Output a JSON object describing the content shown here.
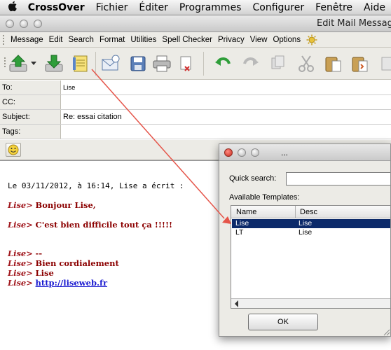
{
  "menubar": {
    "app": "CrossOver",
    "items": [
      "Fichier",
      "Éditer",
      "Programmes",
      "Configurer",
      "Fenêtre",
      "Aide"
    ]
  },
  "window": {
    "title": "Edit Mail Message"
  },
  "appmenu": {
    "items": [
      "Message",
      "Edit",
      "Search",
      "Format",
      "Utilities",
      "Spell Checker",
      "Privacy",
      "View",
      "Options"
    ]
  },
  "fields": {
    "to": {
      "label": "To:",
      "value": "Lise"
    },
    "cc": {
      "label": "CC:",
      "value": ""
    },
    "subject": {
      "label": "Subject:",
      "value": "Re: essai citation"
    },
    "tags": {
      "label": "Tags:",
      "value": ""
    }
  },
  "message": {
    "intro": "Le 03/11/2012, à 16:14, Lise a écrit :",
    "quote_prefix": "Lise>",
    "q1": "Bonjour Lise,",
    "q2": "C'est bien difficile tout ça !!!!!",
    "sig_dash": "--",
    "sig1": "Bien cordialement",
    "sig2": "Lise",
    "sig_link": "http://liseweb.fr"
  },
  "dialog": {
    "title": "...",
    "search_label": "Quick search:",
    "search_value": "",
    "templates_label": "Available Templates:",
    "col_name": "Name",
    "col_desc": "Desc",
    "rows": [
      {
        "name": "Lise",
        "desc": "Lise"
      },
      {
        "name": "LT",
        "desc": "Lise"
      }
    ],
    "ok_label": "OK"
  },
  "colors": {
    "quote": "#a0161c",
    "link": "#1a1ad0",
    "selection": "#0c2a6a",
    "arrow": "#e5554a"
  }
}
